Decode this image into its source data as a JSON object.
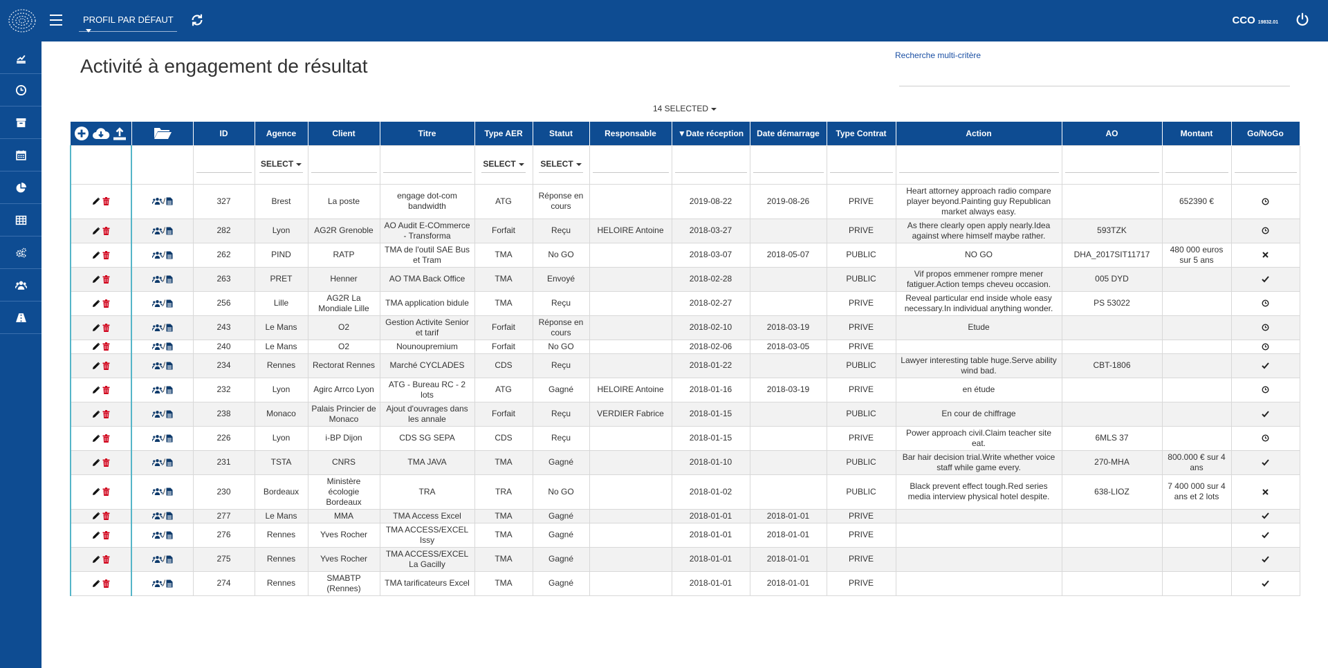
{
  "header": {
    "profile_label": "PROFIL PAR DÉFAUT",
    "user_label": "CCO",
    "user_code": "19832.01"
  },
  "sidebar": {
    "items": [
      {
        "icon": "dashboard-icon"
      },
      {
        "icon": "clock-icon"
      },
      {
        "icon": "archive-icon"
      },
      {
        "icon": "calendar-icon"
      },
      {
        "icon": "pie-chart-icon"
      },
      {
        "icon": "table-icon"
      },
      {
        "icon": "settings-icon"
      },
      {
        "icon": "users-icon"
      },
      {
        "icon": "road-icon"
      }
    ]
  },
  "page": {
    "title": "Activité à engagement de résultat",
    "multi_search_link": "Recherche multi-critère",
    "selected_label": "14 SELECTED"
  },
  "colors": {
    "brand": "#0e4c92",
    "delete": "#d0021b",
    "accent_border": "#55b5c8"
  },
  "table": {
    "columns": [
      "ID",
      "Agence",
      "Client",
      "Titre",
      "Type AER",
      "Statut",
      "Responsable",
      "▼Date réception",
      "Date démarrage",
      "Type Contrat",
      "Action",
      "AO",
      "Montant",
      "Go/NoGo"
    ],
    "filter_select_label": "SELECT",
    "rows": [
      {
        "id": "327",
        "agence": "Brest",
        "client": "La poste",
        "titre": "engage dot-com bandwidth",
        "type": "ATG",
        "statut": "Réponse en cours",
        "resp": "",
        "date_rec": "2019-08-22",
        "date_dem": "2019-08-26",
        "contrat": "PRIVE",
        "action": "Heart attorney approach radio compare player beyond.Painting guy Republican market always easy.",
        "ao": "",
        "montant": "652390 €",
        "gonogo": "pending"
      },
      {
        "id": "282",
        "agence": "Lyon",
        "client": "AG2R Grenoble",
        "titre": "AO Audit E-COmmerce - Transforma",
        "type": "Forfait",
        "statut": "Reçu",
        "resp": "HELOIRE Antoine",
        "date_rec": "2018-03-27",
        "date_dem": "",
        "contrat": "PRIVE",
        "action": "As there clearly open apply nearly.Idea against where himself maybe rather.",
        "ao": "593TZK",
        "montant": "",
        "gonogo": "pending"
      },
      {
        "id": "262",
        "agence": "PIND",
        "client": "RATP",
        "titre": "TMA de l'outil SAE Bus et Tram",
        "type": "TMA",
        "statut": "No GO",
        "resp": "",
        "date_rec": "2018-03-07",
        "date_dem": "2018-05-07",
        "contrat": "PUBLIC",
        "action": "NO GO",
        "ao": "DHA_2017SIT11717",
        "montant": "480 000 euros sur 5 ans",
        "gonogo": "nogo"
      },
      {
        "id": "263",
        "agence": "PRET",
        "client": "Henner",
        "titre": "AO TMA Back Office",
        "type": "TMA",
        "statut": "Envoyé",
        "resp": "",
        "date_rec": "2018-02-28",
        "date_dem": "",
        "contrat": "PUBLIC",
        "action": "Vif propos emmener rompre mener fatiguer.Action temps cheveu occasion.",
        "ao": "005 DYD",
        "montant": "",
        "gonogo": "go"
      },
      {
        "id": "256",
        "agence": "Lille",
        "client": "AG2R La Mondiale Lille",
        "titre": "TMA application bidule",
        "type": "TMA",
        "statut": "Reçu",
        "resp": "",
        "date_rec": "2018-02-27",
        "date_dem": "",
        "contrat": "PRIVE",
        "action": "Reveal particular end inside whole easy necessary.In individual anything wonder.",
        "ao": "PS 53022",
        "montant": "",
        "gonogo": "pending"
      },
      {
        "id": "243",
        "agence": "Le Mans",
        "client": "O2",
        "titre": "Gestion Activite Senior et tarif",
        "type": "Forfait",
        "statut": "Réponse en cours",
        "resp": "",
        "date_rec": "2018-02-10",
        "date_dem": "2018-03-19",
        "contrat": "PRIVE",
        "action": "Etude",
        "ao": "",
        "montant": "",
        "gonogo": "pending"
      },
      {
        "id": "240",
        "agence": "Le Mans",
        "client": "O2",
        "titre": "Nounoupremium",
        "type": "Forfait",
        "statut": "No GO",
        "resp": "",
        "date_rec": "2018-02-06",
        "date_dem": "2018-03-05",
        "contrat": "PRIVE",
        "action": "",
        "ao": "",
        "montant": "",
        "gonogo": "pending"
      },
      {
        "id": "234",
        "agence": "Rennes",
        "client": "Rectorat Rennes",
        "titre": "Marché CYCLADES",
        "type": "CDS",
        "statut": "Reçu",
        "resp": "",
        "date_rec": "2018-01-22",
        "date_dem": "",
        "contrat": "PUBLIC",
        "action": "Lawyer interesting table huge.Serve ability wind bad.",
        "ao": "CBT-1806",
        "montant": "",
        "gonogo": "go"
      },
      {
        "id": "232",
        "agence": "Lyon",
        "client": "Agirc Arrco Lyon",
        "titre": "ATG - Bureau RC - 2 lots",
        "type": "ATG",
        "statut": "Gagné",
        "resp": "HELOIRE Antoine",
        "date_rec": "2018-01-16",
        "date_dem": "2018-03-19",
        "contrat": "PRIVE",
        "action": "en étude",
        "ao": "",
        "montant": "",
        "gonogo": "pending"
      },
      {
        "id": "238",
        "agence": "Monaco",
        "client": "Palais Princier de Monaco",
        "titre": "Ajout d'ouvrages dans les annale",
        "type": "Forfait",
        "statut": "Reçu",
        "resp": "VERDIER Fabrice",
        "date_rec": "2018-01-15",
        "date_dem": "",
        "contrat": "PUBLIC",
        "action": "En cour de chiffrage",
        "ao": "",
        "montant": "",
        "gonogo": "go"
      },
      {
        "id": "226",
        "agence": "Lyon",
        "client": "i-BP Dijon",
        "titre": "CDS SG SEPA",
        "type": "CDS",
        "statut": "Reçu",
        "resp": "",
        "date_rec": "2018-01-15",
        "date_dem": "",
        "contrat": "PRIVE",
        "action": "Power approach civil.Claim teacher site eat.",
        "ao": "6MLS 37",
        "montant": "",
        "gonogo": "pending"
      },
      {
        "id": "231",
        "agence": "TSTA",
        "client": "CNRS",
        "titre": "TMA JAVA",
        "type": "TMA",
        "statut": "Gagné",
        "resp": "",
        "date_rec": "2018-01-10",
        "date_dem": "",
        "contrat": "PUBLIC",
        "action": "Bar hair decision trial.Write whether voice staff while game every.",
        "ao": "270-MHA",
        "montant": "800.000 € sur 4 ans",
        "gonogo": "go"
      },
      {
        "id": "230",
        "agence": "Bordeaux",
        "client": "Ministère écologie Bordeaux",
        "titre": "TRA",
        "type": "TRA",
        "statut": "No GO",
        "resp": "",
        "date_rec": "2018-01-02",
        "date_dem": "",
        "contrat": "PUBLIC",
        "action": "Black prevent effect tough.Red series media interview physical hotel despite.",
        "ao": "638-LIOZ",
        "montant": "7 400 000 sur 4 ans et 2 lots",
        "gonogo": "nogo"
      },
      {
        "id": "277",
        "agence": "Le Mans",
        "client": "MMA",
        "titre": "TMA Access Excel",
        "type": "TMA",
        "statut": "Gagné",
        "resp": "",
        "date_rec": "2018-01-01",
        "date_dem": "2018-01-01",
        "contrat": "PRIVE",
        "action": "",
        "ao": "",
        "montant": "",
        "gonogo": "go"
      },
      {
        "id": "276",
        "agence": "Rennes",
        "client": "Yves Rocher",
        "titre": "TMA ACCESS/EXCEL Issy",
        "type": "TMA",
        "statut": "Gagné",
        "resp": "",
        "date_rec": "2018-01-01",
        "date_dem": "2018-01-01",
        "contrat": "PRIVE",
        "action": "",
        "ao": "",
        "montant": "",
        "gonogo": "go"
      },
      {
        "id": "275",
        "agence": "Rennes",
        "client": "Yves Rocher",
        "titre": "TMA ACCESS/EXCEL La Gacilly",
        "type": "TMA",
        "statut": "Gagné",
        "resp": "",
        "date_rec": "2018-01-01",
        "date_dem": "2018-01-01",
        "contrat": "PRIVE",
        "action": "",
        "ao": "",
        "montant": "",
        "gonogo": "go"
      },
      {
        "id": "274",
        "agence": "Rennes",
        "client": "SMABTP (Rennes)",
        "titre": "TMA tarificateurs Excel",
        "type": "TMA",
        "statut": "Gagné",
        "resp": "",
        "date_rec": "2018-01-01",
        "date_dem": "2018-01-01",
        "contrat": "PRIVE",
        "action": "",
        "ao": "",
        "montant": "",
        "gonogo": "go"
      }
    ]
  }
}
